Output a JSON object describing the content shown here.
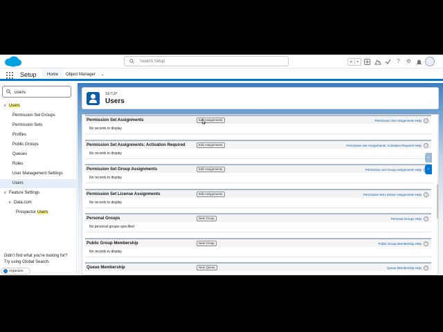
{
  "header": {
    "search_placeholder": "Search Setup",
    "icons": [
      "favorites-star-icon",
      "favorites-dropdown-icon",
      "add-icon",
      "trailhead-icon",
      "help-icon",
      "setup-gear-icon",
      "notifications-bell-icon",
      "avatar"
    ]
  },
  "context_bar": {
    "app_name": "Setup",
    "tabs": [
      {
        "label": "Home",
        "active": true
      },
      {
        "label": "Object Manager",
        "active": false
      }
    ]
  },
  "sidebar": {
    "quickfind_value": "users",
    "items": [
      {
        "chev": "∨",
        "label": "Users",
        "highlight": "Users",
        "indent": 0
      },
      {
        "label": "Permission Set Groups",
        "indent": 2
      },
      {
        "label": "Permission Sets",
        "indent": 2
      },
      {
        "label": "Profiles",
        "indent": 2
      },
      {
        "label": "Public Groups",
        "indent": 2
      },
      {
        "label": "Queues",
        "indent": 2
      },
      {
        "label": "Roles",
        "indent": 2
      },
      {
        "label": "User Management Settings",
        "indent": 2
      },
      {
        "label": "Users",
        "indent": 2,
        "selected": true
      },
      {
        "chev": "∨",
        "label": "Feature Settings",
        "indent": 0
      },
      {
        "chev": "∨",
        "label": "Data.com",
        "indent": 1
      },
      {
        "label": "Prospector",
        "suffix": "Users",
        "indent": 3
      }
    ],
    "hint_line1": "Didn't find what you're looking for?",
    "hint_line2": "Try using Global Search."
  },
  "organizer": {
    "label": "organizer",
    "badge": "i"
  },
  "page": {
    "breadcrumb": "SETUP",
    "title": "Users"
  },
  "related_lists": [
    {
      "title": "Permission Set Assignments",
      "button": "Edit Assignments",
      "help": "Permission Set Assignments Help",
      "empty": "No records to display"
    },
    {
      "title": "Permission Set Assignments: Activation Required",
      "button": "Edit Assignments",
      "help": "Permission Set Assignments: Activation Required Help",
      "empty": "No records to display"
    },
    {
      "title": "Permission Set Group Assignments",
      "button": "Edit Assignments",
      "help": "Permission Set Group Assignments Help",
      "empty": "No records to display"
    },
    {
      "title": "Permission Set License Assignments",
      "button": "Edit Assignments",
      "help": "Permission Set License Assignments Help",
      "empty": "No records to display"
    },
    {
      "title": "Personal Groups",
      "button": "New Group",
      "help": "Personal Groups Help",
      "empty": "No personal groups specified"
    },
    {
      "title": "Public Group Membership",
      "button": "New Group",
      "help": "Public Group Membership Help",
      "empty": "No records to display"
    },
    {
      "title": "Queue Membership",
      "button": "New Queue",
      "help": "Queue Membership Help",
      "empty": ""
    }
  ],
  "help_glyph": "?",
  "side_tabs": [
    "‹",
    "‹"
  ],
  "colors": {
    "brand": "#0176d3",
    "header_band": "#2f6fa7",
    "highlight": "#fbf48b",
    "link": "#0b5cab"
  }
}
